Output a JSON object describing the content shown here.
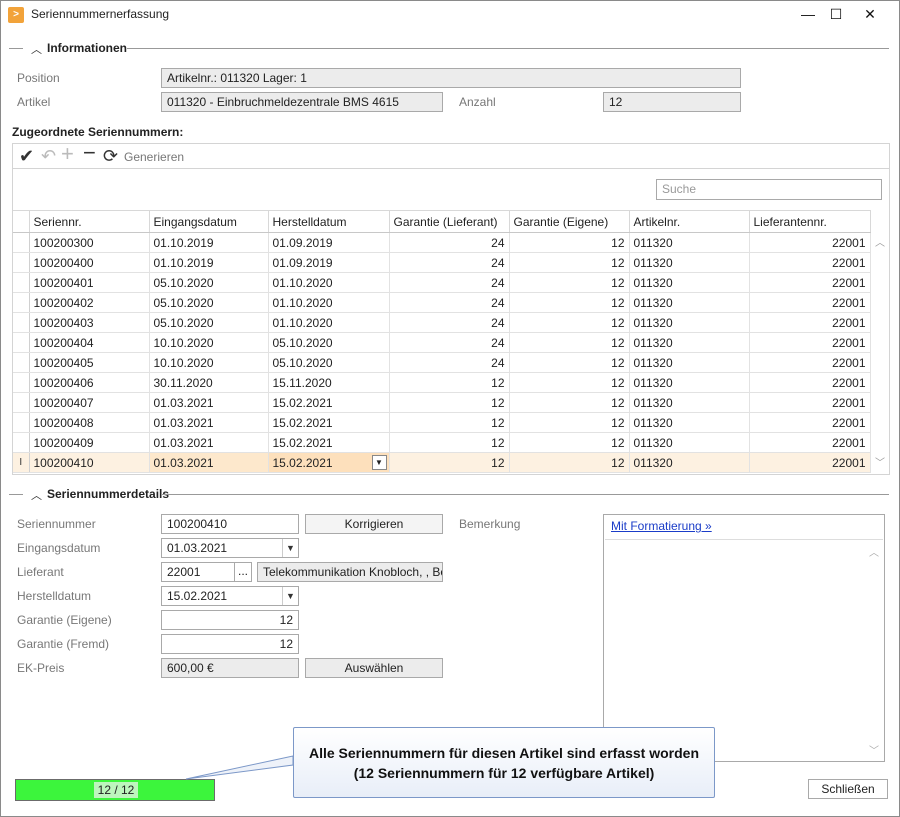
{
  "window": {
    "title": "Seriennummernerfassung",
    "controls": {
      "minimize": "—",
      "maximize": "☐",
      "close": "✕"
    }
  },
  "info": {
    "section_title": "Informationen",
    "position_label": "Position",
    "position_value": "Artikelnr.: 011320 Lager: 1",
    "artikel_label": "Artikel",
    "artikel_value": "011320 - Einbruchmeldezentrale BMS 4615",
    "anzahl_label": "Anzahl",
    "anzahl_value": "12"
  },
  "assigned": {
    "title": "Zugeordnete Seriennummern:",
    "toolbar": {
      "generate_label": "Generieren"
    },
    "search_placeholder": "Suche",
    "columns": [
      "Seriennr.",
      "Eingangsdatum",
      "Herstelldatum",
      "Garantie (Lieferant)",
      "Garantie (Eigene)",
      "Artikelnr.",
      "Lieferantennr."
    ],
    "rows": [
      [
        "100200300",
        "01.10.2019",
        "01.09.2019",
        "24",
        "12",
        "011320",
        "22001"
      ],
      [
        "100200400",
        "01.10.2019",
        "01.09.2019",
        "24",
        "12",
        "011320",
        "22001"
      ],
      [
        "100200401",
        "05.10.2020",
        "01.10.2020",
        "24",
        "12",
        "011320",
        "22001"
      ],
      [
        "100200402",
        "05.10.2020",
        "01.10.2020",
        "24",
        "12",
        "011320",
        "22001"
      ],
      [
        "100200403",
        "05.10.2020",
        "01.10.2020",
        "24",
        "12",
        "011320",
        "22001"
      ],
      [
        "100200404",
        "10.10.2020",
        "05.10.2020",
        "24",
        "12",
        "011320",
        "22001"
      ],
      [
        "100200405",
        "10.10.2020",
        "05.10.2020",
        "24",
        "12",
        "011320",
        "22001"
      ],
      [
        "100200406",
        "30.11.2020",
        "15.11.2020",
        "12",
        "12",
        "011320",
        "22001"
      ],
      [
        "100200407",
        "01.03.2021",
        "15.02.2021",
        "12",
        "12",
        "011320",
        "22001"
      ],
      [
        "100200408",
        "01.03.2021",
        "15.02.2021",
        "12",
        "12",
        "011320",
        "22001"
      ],
      [
        "100200409",
        "01.03.2021",
        "15.02.2021",
        "12",
        "12",
        "011320",
        "22001"
      ],
      [
        "100200410",
        "01.03.2021",
        "15.02.2021",
        "12",
        "12",
        "011320",
        "22001"
      ]
    ],
    "selected_row_index": 11,
    "selected_row_indicator": "I"
  },
  "details": {
    "section_title": "Seriennummerdetails",
    "seriennummer_label": "Seriennummer",
    "seriennummer_value": "100200410",
    "korrigieren_label": "Korrigieren",
    "bemerkung_label": "Bemerkung",
    "eingangsdatum_label": "Eingangsdatum",
    "eingangsdatum_value": "01.03.2021",
    "lieferant_label": "Lieferant",
    "lieferant_value": "22001",
    "lieferant_browse": "...",
    "lieferant_name": "Telekommunikation Knobloch, , Berli",
    "herstelldatum_label": "Herstelldatum",
    "herstelldatum_value": "15.02.2021",
    "garantie_eigene_label": "Garantie (Eigene)",
    "garantie_eigene_value": "12",
    "garantie_fremd_label": "Garantie (Fremd)",
    "garantie_fremd_value": "12",
    "ekpreis_label": "EK-Preis",
    "ekpreis_value": "600,00 €",
    "auswaehlen_label": "Auswählen",
    "remark_link": "Mit Formatierung »"
  },
  "footer": {
    "progress_text": "12 / 12",
    "progress_fraction": 1.0,
    "progress_color": "#3cf53c",
    "callout_line1": "Alle Seriennummern für diesen Artikel sind erfasst worden",
    "callout_line2": "(12 Seriennummern für 12 verfügbare Artikel)",
    "close_label": "Schließen"
  }
}
